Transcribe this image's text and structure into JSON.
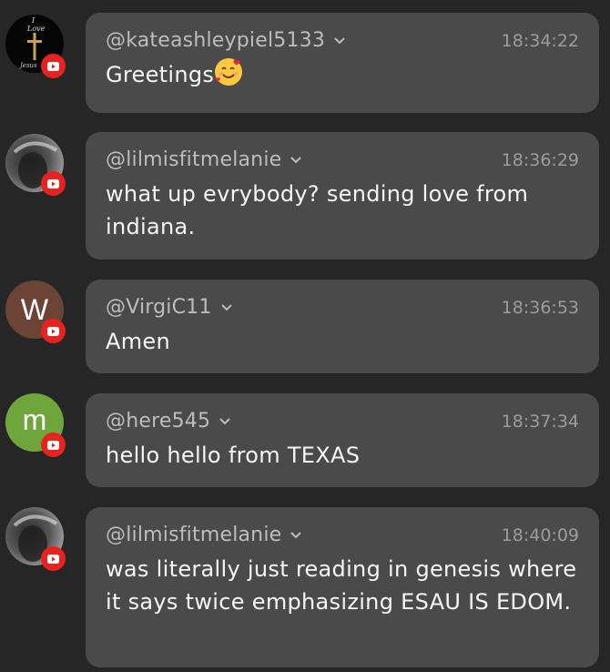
{
  "messages": [
    {
      "username": "@kateashleypiel5133",
      "time": "18:34:22",
      "text": "Greetings",
      "emoji": "smiling-face-with-hearts",
      "avatar": {
        "type": "image",
        "caption_top": "I",
        "caption": "Love",
        "caption_bottom": "Jesus"
      }
    },
    {
      "username": "@lilmisfitmelanie",
      "time": "18:36:29",
      "text": "what up evrybody? sending love from indiana.",
      "avatar": {
        "type": "photo"
      }
    },
    {
      "username": "@VirgiC11",
      "time": "18:36:53",
      "text": "Amen",
      "avatar": {
        "type": "letter",
        "letter": "W",
        "color": "#6b4436"
      }
    },
    {
      "username": "@here545",
      "time": "18:37:34",
      "text": "hello hello from TEXAS",
      "avatar": {
        "type": "letter",
        "letter": "m",
        "color": "#6fa63b"
      }
    },
    {
      "username": "@lilmisfitmelanie",
      "time": "18:40:09",
      "text": "was literally just reading in genesis where it says twice emphasizing ESAU IS EDOM.",
      "avatar": {
        "type": "photo"
      }
    }
  ],
  "colors": {
    "background": "#262626",
    "bubble": "#4a4a4a",
    "badge": "#e8231f"
  },
  "icons": {
    "badge": "youtube-icon",
    "dropdown": "chevron-down-icon"
  }
}
